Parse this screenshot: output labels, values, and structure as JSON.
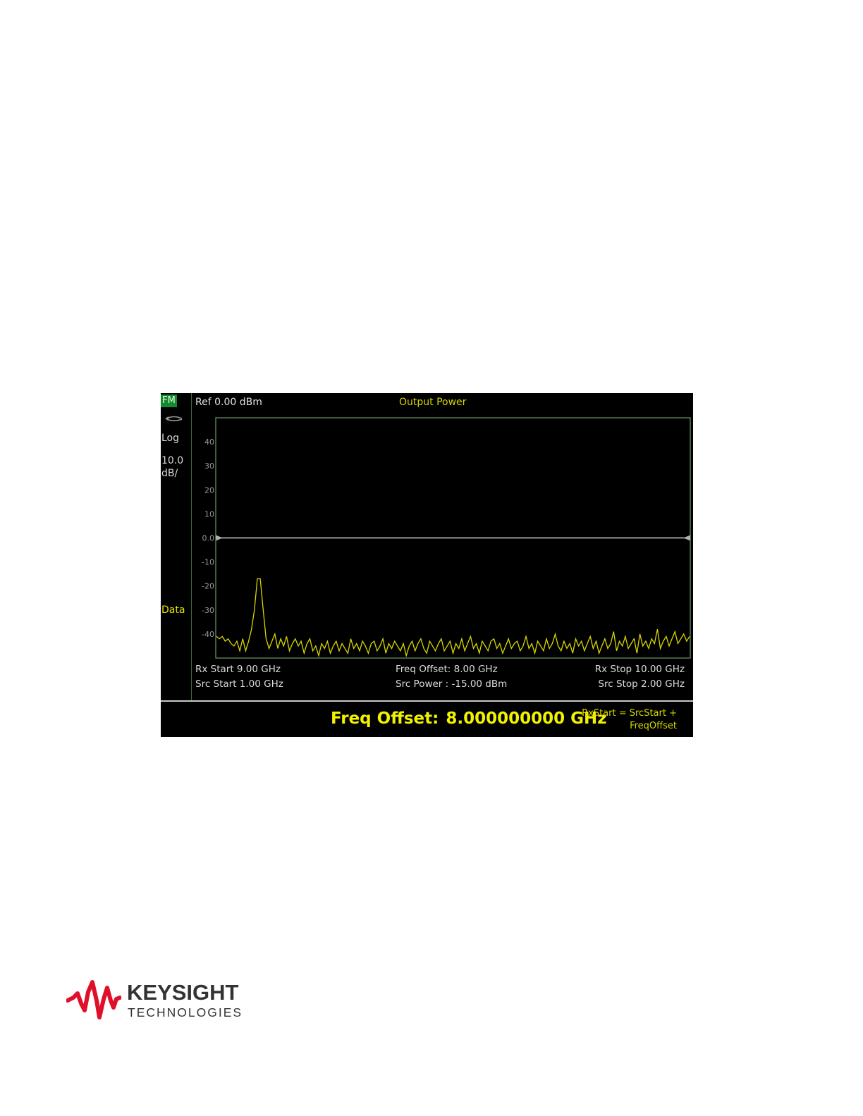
{
  "screen": {
    "mode_badge": "FM",
    "sweep_icon": "sweep-arrow-icon",
    "scale_type": "Log",
    "scale_value": "10.0",
    "scale_unit": "dB/",
    "trace_label": "Data",
    "ref_level": "Ref 0.00 dBm",
    "title": "Output Power",
    "y_tick_labels": [
      "40",
      "30",
      "20",
      "10",
      "0.0",
      "-10",
      "-20",
      "-30",
      "-40"
    ],
    "info": {
      "rx_start": "Rx Start 9.00 GHz",
      "src_start": "Src Start 1.00 GHz",
      "freq_offset": "Freq Offset: 8.00 GHz",
      "src_power": "Src Power : -15.00  dBm",
      "rx_stop": "Rx Stop 10.00 GHz",
      "src_stop": "Src Stop 2.00 GHz"
    },
    "active_entry": {
      "label": "Freq Offset:",
      "value": "8.000000000 GHz",
      "hint_line1": "RxStart = SrcStart +",
      "hint_line2": "FreqOffset"
    },
    "colors": {
      "trace": "#d8d800",
      "mode_badge": "#138a2c",
      "reference_line": "#d0d0d0",
      "grid_border": "#6a9a6a"
    }
  },
  "chart_data": {
    "type": "line",
    "x_range_ghz": [
      9.0,
      10.0
    ],
    "ylim": [
      -50,
      50
    ],
    "y_ticks": [
      40,
      30,
      20,
      10,
      0,
      -10,
      -20,
      -30,
      -40
    ],
    "reference_level_dbm": 0.0,
    "series": [
      {
        "values": [
          -41,
          -42,
          -41,
          -43,
          -42,
          -44,
          -45,
          -43,
          -47,
          -42,
          -47,
          -43,
          -38,
          -30,
          -17,
          -17,
          -30,
          -42,
          -46,
          -43,
          -40,
          -46,
          -42,
          -45,
          -41,
          -47,
          -44,
          -42,
          -45,
          -43,
          -48,
          -44,
          -42,
          -47,
          -45,
          -49,
          -44,
          -46,
          -43,
          -48,
          -45,
          -43,
          -47,
          -44,
          -46,
          -48,
          -42,
          -46,
          -44,
          -47,
          -43,
          -45,
          -48,
          -44,
          -43,
          -47,
          -45,
          -42,
          -48,
          -44,
          -46,
          -43,
          -45,
          -47,
          -44,
          -49,
          -45,
          -43,
          -47,
          -44,
          -42,
          -46,
          -48,
          -43,
          -45,
          -47,
          -44,
          -42,
          -47,
          -45,
          -43,
          -48,
          -44,
          -46,
          -42,
          -47,
          -44,
          -41,
          -46,
          -44,
          -48,
          -43,
          -45,
          -47,
          -43,
          -42,
          -46,
          -44,
          -48,
          -45,
          -42,
          -46,
          -44,
          -43,
          -47,
          -45,
          -41,
          -46,
          -44,
          -48,
          -43,
          -45,
          -47,
          -42,
          -46,
          -44,
          -40,
          -45,
          -47,
          -43,
          -46,
          -44,
          -48,
          -42,
          -45,
          -43,
          -47,
          -44,
          -41,
          -46,
          -43,
          -48,
          -45,
          -42,
          -46,
          -44,
          -39,
          -47,
          -43,
          -45,
          -41,
          -46,
          -44,
          -42,
          -48,
          -40,
          -45,
          -43,
          -46,
          -42,
          -44,
          -38,
          -46,
          -43,
          -41,
          -45,
          -42,
          -39,
          -44,
          -42,
          -40,
          -43,
          -41
        ]
      }
    ]
  },
  "logo": {
    "name": "KEYSIGHT",
    "sub": "TECHNOLOGIES",
    "color_wave": "#e0102a",
    "color_text": "#333333"
  }
}
